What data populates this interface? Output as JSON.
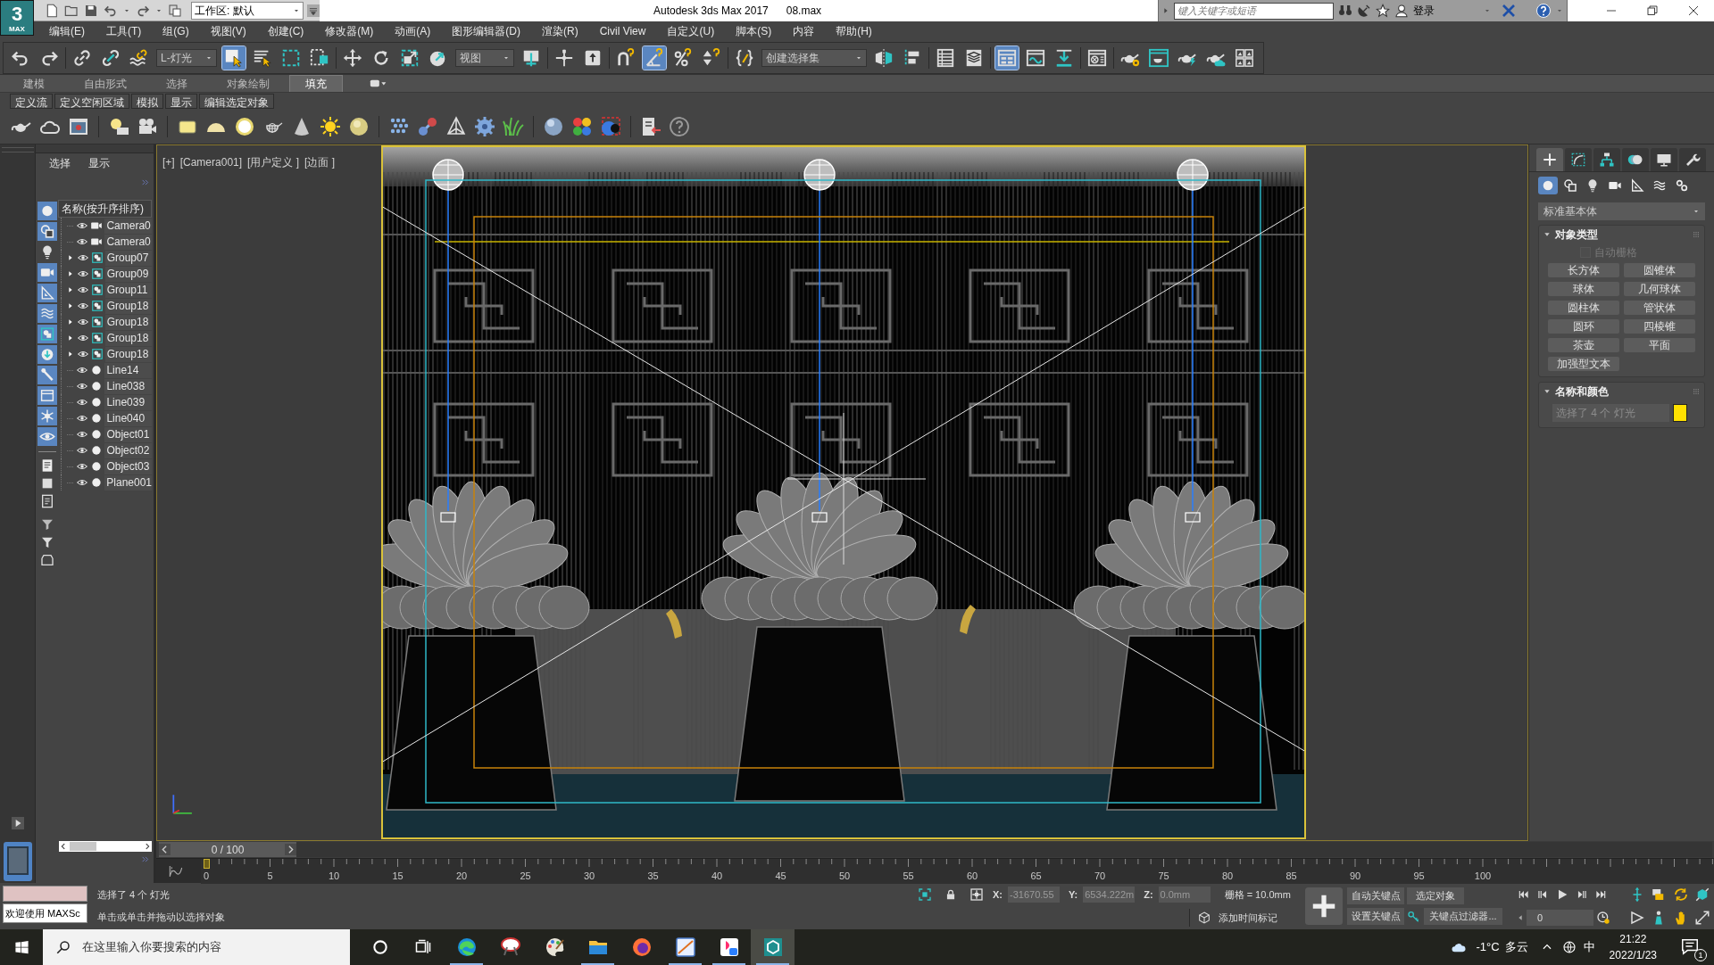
{
  "title_bar": {
    "logo": {
      "mark": "3",
      "caption": "MAX"
    },
    "workspace": "工作区: 默认",
    "app_title": "Autodesk 3ds Max 2017",
    "file_name": "08.max",
    "search_placeholder": "键入关键字或短语",
    "sign_in": "登录"
  },
  "menu_bar": [
    "编辑(E)",
    "工具(T)",
    "组(G)",
    "视图(V)",
    "创建(C)",
    "修改器(M)",
    "动画(A)",
    "图形编辑器(D)",
    "渲染(R)",
    "Civil View",
    "自定义(U)",
    "脚本(S)",
    "内容",
    "帮助(H)"
  ],
  "main_toolbar": {
    "selection_filter": "L-灯光",
    "reference_coordinate_system": "视图",
    "named_selection_set": "创建选择集",
    "buttons": [
      {
        "selected": false
      },
      {
        "selected": false
      },
      {
        "selected": false
      },
      {
        "selected": false
      },
      {
        "selected": false
      },
      {
        "selected": true
      },
      {
        "selected": false
      },
      {
        "selected": false
      },
      {
        "selected": false
      },
      {
        "selected": false
      },
      {
        "selected": false
      },
      {
        "selected": false
      },
      {
        "selected": false
      },
      {
        "selected": false
      },
      {
        "selected": false
      },
      {
        "selected": false
      },
      {
        "selected": false
      },
      {
        "selected": true
      },
      {
        "selected": false
      },
      {
        "selected": false
      },
      {
        "selected": false
      },
      {
        "selected": false
      },
      {
        "selected": false
      },
      {
        "selected": false
      },
      {
        "selected": false
      },
      {
        "selected": true
      },
      {
        "selected": false
      },
      {
        "selected": false
      },
      {
        "selected": false
      },
      {
        "selected": false
      },
      {
        "selected": false
      },
      {
        "selected": false
      },
      {
        "selected": false
      },
      {
        "selected": false
      }
    ]
  },
  "ribbon": {
    "tabs": [
      {
        "label": "建模",
        "selected": false
      },
      {
        "label": "自由形式",
        "selected": false
      },
      {
        "label": "选择",
        "selected": false
      },
      {
        "label": "对象绘制",
        "selected": false
      },
      {
        "label": "填充",
        "selected": true
      }
    ],
    "panels": [
      "定义流",
      "定义空闲区域",
      "模拟",
      "显示",
      "编辑选定对象"
    ]
  },
  "scene_explorer": {
    "tabs": [
      "选择",
      "显示"
    ],
    "filters": [
      {
        "on": true
      },
      {
        "on": true
      },
      {
        "on": false
      },
      {
        "on": true
      },
      {
        "on": true
      },
      {
        "on": true
      },
      {
        "on": true
      },
      {
        "on": true
      },
      {
        "on": true
      },
      {
        "on": true
      },
      {
        "on": true
      },
      {
        "on": true
      }
    ],
    "column_header": "名称(按升序排序)",
    "rows": [
      {
        "name": "Camera0",
        "kind": "camera",
        "expandable": false
      },
      {
        "name": "Camera0",
        "kind": "camera",
        "expandable": false
      },
      {
        "name": "Group07",
        "kind": "group",
        "expandable": true
      },
      {
        "name": "Group09",
        "kind": "group",
        "expandable": true
      },
      {
        "name": "Group11",
        "kind": "group",
        "expandable": true
      },
      {
        "name": "Group18",
        "kind": "group",
        "expandable": true
      },
      {
        "name": "Group18",
        "kind": "group",
        "expandable": true
      },
      {
        "name": "Group18",
        "kind": "group",
        "expandable": true
      },
      {
        "name": "Group18",
        "kind": "group",
        "expandable": true
      },
      {
        "name": "Line14",
        "kind": "geometry",
        "expandable": false
      },
      {
        "name": "Line038",
        "kind": "geometry",
        "expandable": false
      },
      {
        "name": "Line039",
        "kind": "geometry",
        "expandable": false
      },
      {
        "name": "Line040",
        "kind": "geometry",
        "expandable": false
      },
      {
        "name": "Object01",
        "kind": "geometry",
        "expandable": false
      },
      {
        "name": "Object02",
        "kind": "geometry",
        "expandable": false
      },
      {
        "name": "Object03",
        "kind": "geometry",
        "expandable": false
      },
      {
        "name": "Plane001",
        "kind": "geometry",
        "expandable": false
      }
    ]
  },
  "viewport": {
    "labels": [
      "[+]",
      "[Camera001]",
      "[用户定义 ]",
      "[边面 ]"
    ]
  },
  "command_panel": {
    "tabs": [
      {
        "selected": true
      },
      {
        "selected": false
      },
      {
        "selected": false
      },
      {
        "selected": false
      },
      {
        "selected": false
      },
      {
        "selected": false
      }
    ],
    "categories": [
      {
        "selected": true
      },
      {
        "selected": false
      },
      {
        "selected": false
      },
      {
        "selected": false
      },
      {
        "selected": false
      },
      {
        "selected": false
      },
      {
        "selected": false
      }
    ],
    "object_category": "标准基本体",
    "object_type": {
      "title": "对象类型",
      "expanded": true,
      "autogrid": {
        "label": "自动栅格",
        "checked": false,
        "disabled": true
      },
      "buttons": [
        "长方体",
        "圆锥体",
        "球体",
        "几何球体",
        "圆柱体",
        "管状体",
        "圆环",
        "四棱锥",
        "茶壶",
        "平面",
        "加强型文本"
      ]
    },
    "name_and_color": {
      "title": "名称和颜色",
      "expanded": true,
      "name": "选择了 4 个 灯光",
      "color": "#ffe100"
    }
  },
  "time_slider": {
    "label": "0 / 100",
    "level": 0
  },
  "track_bar": {
    "labels": [
      "0",
      "5",
      "10",
      "15",
      "20",
      "25",
      "30",
      "35",
      "40",
      "45",
      "50",
      "55",
      "60",
      "65",
      "70",
      "75",
      "80",
      "85",
      "90",
      "95",
      "100"
    ]
  },
  "maxscript": {
    "listener": "欢迎使用 MAXSc"
  },
  "status_bar": {
    "selection_info": "选择了 4 个 灯光",
    "prompt": "单击或单击并拖动以选择对象",
    "coordinates": [
      {
        "axis": "X:",
        "value": "-31670.55"
      },
      {
        "axis": "Y:",
        "value": "6534.222m"
      },
      {
        "axis": "Z:",
        "value": "0.0mm"
      }
    ],
    "grid": "栅格 = 10.0mm",
    "add_time_tag": "添加时间标记"
  },
  "animation_controls": {
    "auto_key": {
      "label": "自动关键点",
      "on": false
    },
    "key_target": "选定对象",
    "set_key": "设置关键点",
    "key_filters": "关键点过滤器...",
    "current_frame": "0"
  },
  "taskbar": {
    "search_placeholder": "在这里输入你要搜索的内容",
    "apps": [
      {
        "running": true,
        "selected": false
      },
      {
        "running": false,
        "selected": false
      },
      {
        "running": false,
        "selected": false
      },
      {
        "running": true,
        "selected": false
      },
      {
        "running": false,
        "selected": false
      },
      {
        "running": true,
        "selected": false
      },
      {
        "running": true,
        "selected": false
      },
      {
        "running": true,
        "selected": true
      }
    ],
    "weather": "-1°C",
    "weather_condition": "多云",
    "input_method": "中",
    "time": "21:22",
    "date": "2022/1/23",
    "notification_count": "1"
  }
}
